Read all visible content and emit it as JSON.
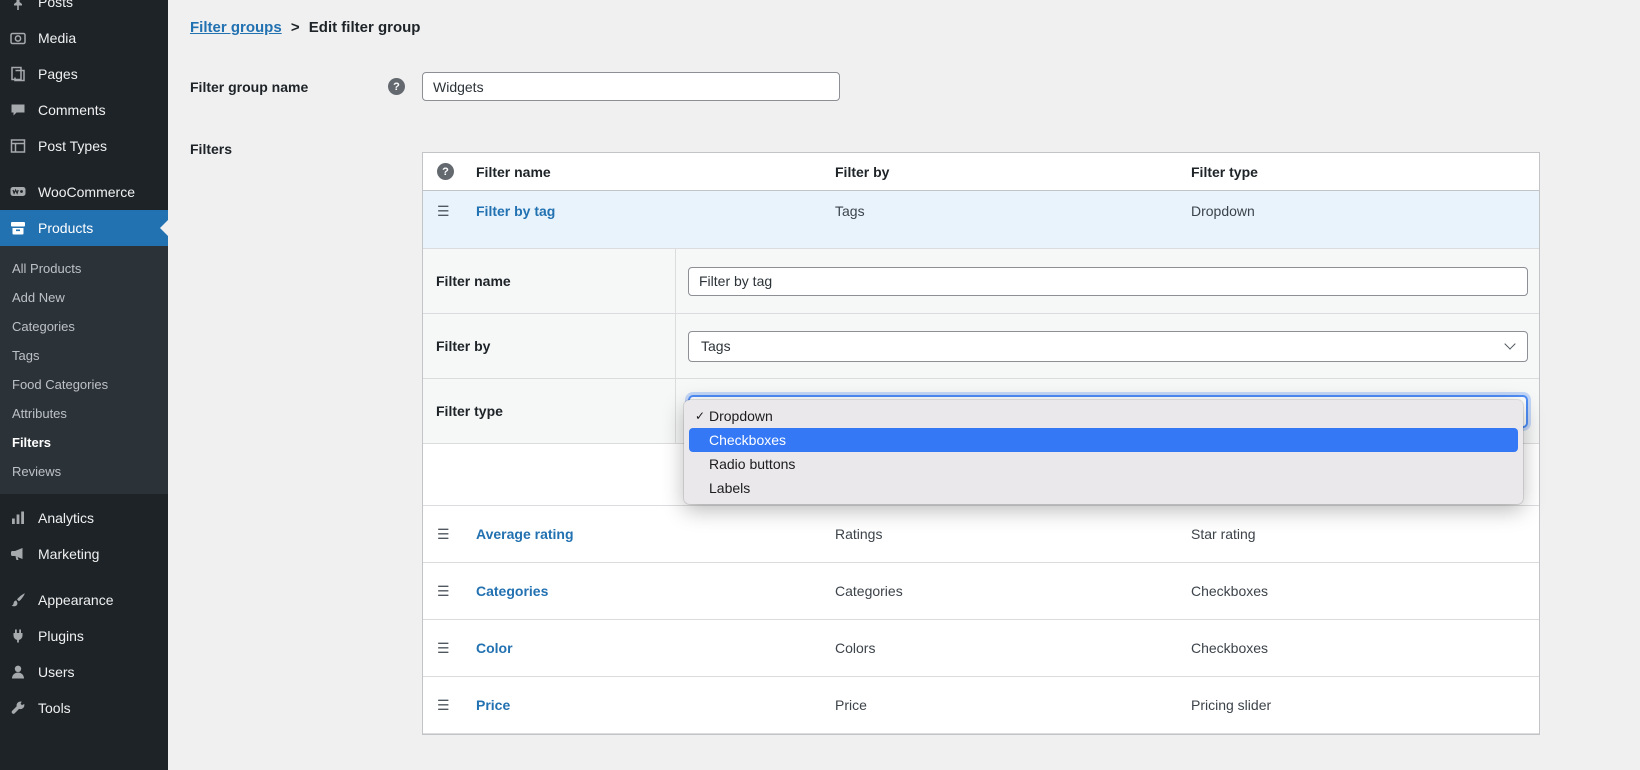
{
  "sidebar": {
    "items": [
      {
        "label": "Posts"
      },
      {
        "label": "Media"
      },
      {
        "label": "Pages"
      },
      {
        "label": "Comments"
      },
      {
        "label": "Post Types"
      },
      {
        "label": "WooCommerce"
      },
      {
        "label": "Products"
      },
      {
        "label": "Analytics"
      },
      {
        "label": "Marketing"
      },
      {
        "label": "Appearance"
      },
      {
        "label": "Plugins"
      },
      {
        "label": "Users"
      },
      {
        "label": "Tools"
      }
    ],
    "active_item": "Products",
    "submenu": {
      "items": [
        {
          "label": "All Products"
        },
        {
          "label": "Add New"
        },
        {
          "label": "Categories"
        },
        {
          "label": "Tags"
        },
        {
          "label": "Food Categories"
        },
        {
          "label": "Attributes"
        },
        {
          "label": "Filters"
        },
        {
          "label": "Reviews"
        }
      ],
      "current": "Filters"
    }
  },
  "breadcrumb": {
    "link": "Filter groups",
    "separator": ">",
    "current": "Edit filter group"
  },
  "form": {
    "group_name": {
      "label": "Filter group name",
      "value": "Widgets"
    },
    "filters_label": "Filters"
  },
  "filters_table": {
    "headers": {
      "name": "Filter name",
      "by": "Filter by",
      "type": "Filter type"
    },
    "selected_row": {
      "name": "Filter by tag",
      "by": "Tags",
      "type": "Dropdown"
    },
    "rows": [
      {
        "name": "Average rating",
        "by": "Ratings",
        "type": "Star rating"
      },
      {
        "name": "Categories",
        "by": "Categories",
        "type": "Checkboxes"
      },
      {
        "name": "Color",
        "by": "Colors",
        "type": "Checkboxes"
      },
      {
        "name": "Price",
        "by": "Price",
        "type": "Pricing slider"
      }
    ]
  },
  "editor": {
    "filter_name": {
      "label": "Filter name",
      "value": "Filter by tag"
    },
    "filter_by": {
      "label": "Filter by",
      "value": "Tags"
    },
    "filter_type": {
      "label": "Filter type"
    }
  },
  "type_menu": {
    "check_glyph": "✓",
    "options": [
      {
        "label": "Dropdown",
        "checked": true
      },
      {
        "label": "Checkboxes",
        "highlighted": true
      },
      {
        "label": "Radio buttons"
      },
      {
        "label": "Labels"
      }
    ]
  },
  "icons": {
    "help_glyph": "?",
    "drag_glyph": "☰"
  },
  "colors": {
    "accent": "#2271b1",
    "selection_blue": "#3478f6",
    "sidebar_bg": "#1d2327",
    "selected_row_bg": "#e8f3fc"
  }
}
